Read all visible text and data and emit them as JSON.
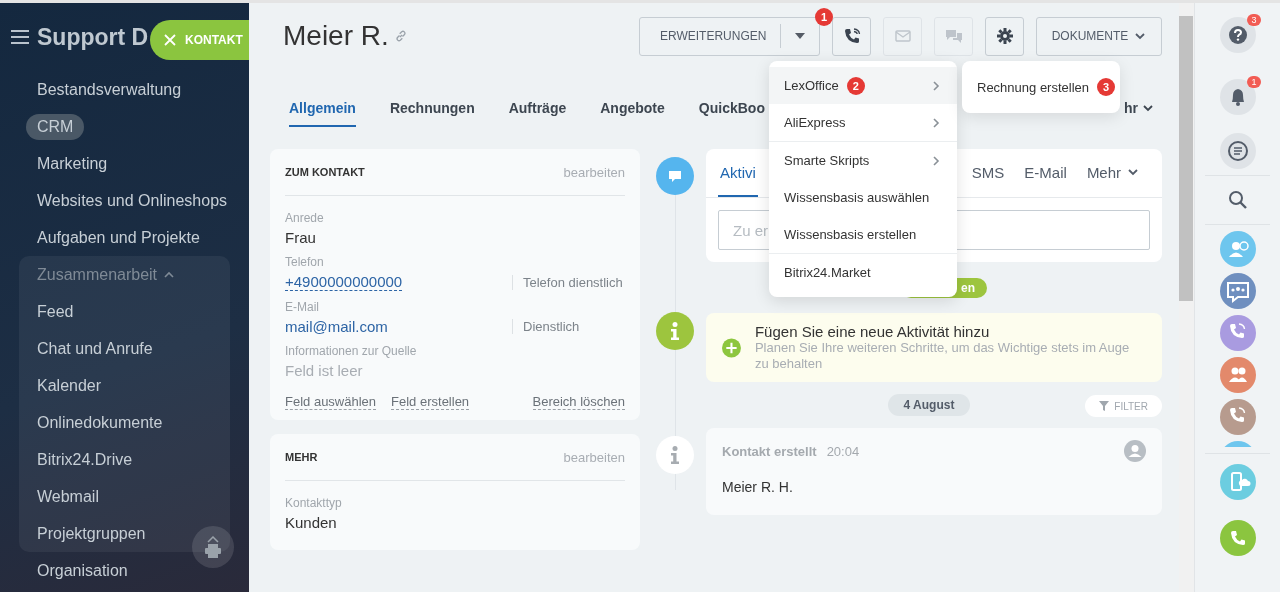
{
  "sidebar": {
    "title": "Support D",
    "items": [
      {
        "kind": "item",
        "label": "Bestandsverwaltung",
        "selected": false
      },
      {
        "kind": "item",
        "label": "CRM",
        "selected": true
      },
      {
        "kind": "item",
        "label": "Marketing",
        "selected": false
      },
      {
        "kind": "item",
        "label": "Websites und Onlineshops",
        "selected": false
      },
      {
        "kind": "item",
        "label": "Aufgaben und Projekte",
        "selected": false
      },
      {
        "kind": "group",
        "label": "Zusammenarbeit",
        "selected": false,
        "expanded": true,
        "children": [
          {
            "label": "Feed",
            "selected": false
          },
          {
            "label": "Chat und Anrufe",
            "selected": false
          },
          {
            "label": "Kalender",
            "selected": false
          },
          {
            "label": "Onlinedokumente",
            "selected": false
          },
          {
            "label": "Bitrix24.Drive",
            "selected": false
          },
          {
            "label": "Webmail",
            "selected": false
          },
          {
            "label": "Projektgruppen",
            "selected": false
          }
        ]
      },
      {
        "kind": "item",
        "label": "Organisation",
        "selected": false
      }
    ]
  },
  "close_button": {
    "label": "KONTAKT"
  },
  "header": {
    "title": "Meier R.",
    "buttons": [
      {
        "kind": "split",
        "label": "ERWEITERUNGEN",
        "marker": "1",
        "disabled": false
      },
      {
        "kind": "phone",
        "disabled": false
      },
      {
        "kind": "mail",
        "disabled": true
      },
      {
        "kind": "chat",
        "disabled": true
      },
      {
        "kind": "settings",
        "disabled": false
      },
      {
        "kind": "dropdown",
        "label": "DOKUMENTE",
        "disabled": false
      }
    ]
  },
  "tabs": [
    {
      "kind": "tab",
      "label": "Allgemein",
      "selected": true
    },
    {
      "kind": "tab",
      "label": "Rechnungen",
      "selected": false
    },
    {
      "kind": "tab",
      "label": "Aufträge",
      "selected": false
    },
    {
      "kind": "tab",
      "label": "Angebote",
      "selected": false
    },
    {
      "kind": "tab",
      "label": "QuickBoo",
      "selected": false
    },
    {
      "kind": "more",
      "label": "hr",
      "selected": false
    }
  ],
  "contact_card": {
    "title": "ZUM KONTAKT",
    "edit": "bearbeiten",
    "fields": [
      {
        "kind": "text",
        "label": "Anrede",
        "value": "Frau"
      },
      {
        "kind": "phone",
        "label": "Telefon",
        "value": "+4900000000000",
        "type_label": "Telefon dienstlich"
      },
      {
        "kind": "link",
        "label": "E-Mail",
        "value": "mail@mail.com",
        "type_label": "Dienstlich"
      },
      {
        "kind": "empty",
        "label": "Informationen zur Quelle",
        "value": "Feld ist leer"
      }
    ],
    "actions": [
      "Feld auswählen",
      "Feld erstellen",
      "Bereich löschen"
    ]
  },
  "more_card": {
    "title": "MEHR",
    "edit": "bearbeiten",
    "fields": [
      {
        "kind": "text",
        "label": "Kontakttyp",
        "value": "Kunden"
      }
    ]
  },
  "activity": {
    "tabs": [
      {
        "kind": "tab",
        "label": "Aktivi",
        "selected": true
      },
      {
        "kind": "tab",
        "label": "SMS",
        "selected": false
      },
      {
        "kind": "tab",
        "label": "E-Mail",
        "selected": false
      },
      {
        "kind": "more",
        "label": "Mehr",
        "selected": false
      }
    ],
    "placeholder": "Zu er",
    "pill": "en"
  },
  "hint": {
    "title": "Fügen Sie eine neue Aktivität hinzu",
    "text": "Planen Sie Ihre weiteren Schritte, um das Wichtige stets im Auge zu behalten"
  },
  "date": "4 August",
  "filter": "FILTER",
  "event": {
    "title": "Kontakt erstellt",
    "time": "20:04",
    "text": "Meier R. H."
  },
  "menu": {
    "items": [
      {
        "label": "LexOffice",
        "submenu": true,
        "selected": true,
        "separator": false,
        "marker": "2"
      },
      {
        "label": "AliExpress",
        "submenu": true,
        "selected": false,
        "separator": false
      },
      {
        "label": "Smarte Skripts",
        "submenu": true,
        "selected": false,
        "separator": true
      },
      {
        "label": "Wissensbasis auswählen",
        "submenu": false,
        "selected": false,
        "separator": false
      },
      {
        "label": "Wissensbasis erstellen",
        "submenu": false,
        "selected": false,
        "separator": false
      },
      {
        "label": "Bitrix24.Market",
        "submenu": false,
        "selected": false,
        "separator": true
      }
    ]
  },
  "submenu": {
    "items": [
      {
        "label": "Rechnung erstellen",
        "marker": "3"
      }
    ]
  },
  "right_bar": {
    "items": [
      {
        "kind": "help",
        "badge": "3"
      },
      {
        "kind": "bell",
        "badge": "1"
      },
      {
        "kind": "chat"
      },
      {
        "kind": "search"
      },
      {
        "kind": "avatar-person",
        "color": "#6ec6ee"
      },
      {
        "kind": "avatar-group-chat",
        "color": "#6f8fbf"
      },
      {
        "kind": "avatar-phone",
        "color": "#a99be0"
      },
      {
        "kind": "avatar-group",
        "color": "#e3896b"
      },
      {
        "kind": "avatar-phone",
        "color": "#b79b8e"
      },
      {
        "kind": "avatar-partial",
        "color": "#6ec6ee"
      },
      {
        "kind": "phone-cloud",
        "color": "#6ccde0"
      },
      {
        "kind": "call",
        "color": "#8bc53f"
      }
    ]
  }
}
